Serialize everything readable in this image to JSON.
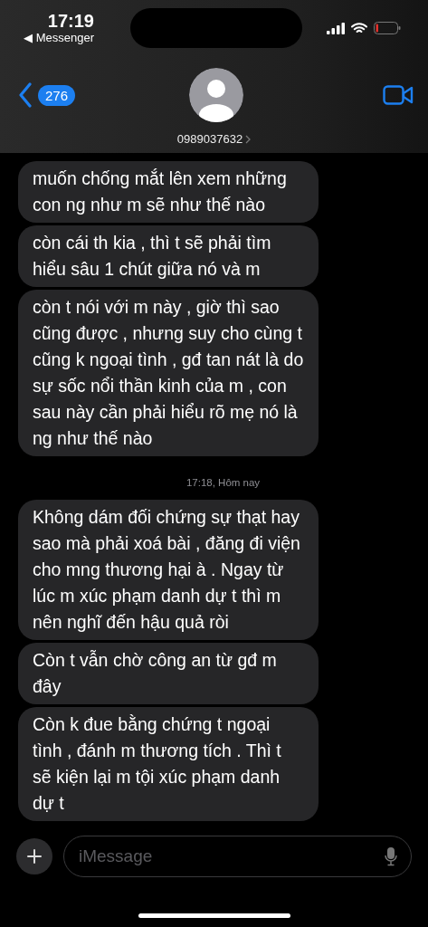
{
  "status_bar": {
    "time": "17:19",
    "back_app": "◀ Messenger"
  },
  "nav": {
    "unread_count": "276",
    "contact": "0989037632"
  },
  "thread": [
    {
      "kind": "bubble",
      "text": "muốn chống mắt lên xem những con ng như m sẽ như thế nào"
    },
    {
      "kind": "bubble",
      "text": "còn cái th kia , thì t sẽ phải tìm hiểu sâu 1 chút giữa nó và m"
    },
    {
      "kind": "bubble",
      "text": "còn t nói với m này , giờ thì sao cũng được , nhưng suy cho cùng t cũng k ngoại tình , gđ tan nát là do sự sốc nổi thần kinh của m , con sau này cần phải hiểu rõ mẹ nó là ng như thế nào"
    },
    {
      "kind": "timestamp",
      "text": "17:18, Hôm nay"
    },
    {
      "kind": "bubble",
      "text": "Không dám đối chứng sự thạt hay sao mà phải xoá bài , đăng đi viện cho mng thương hại à . Ngay từ lúc m xúc phạm danh dự t thì m nên nghĩ đến hậu quả ròi"
    },
    {
      "kind": "bubble",
      "text": "Còn t vẫn chờ công an từ gđ m đây"
    },
    {
      "kind": "bubble",
      "text": "Còn k đue bằng chứng t ngoại tình , đánh m thương tích . Thì t sẽ kiện lại m tội xúc phạm danh dự t"
    }
  ],
  "compose": {
    "placeholder": "iMessage"
  }
}
